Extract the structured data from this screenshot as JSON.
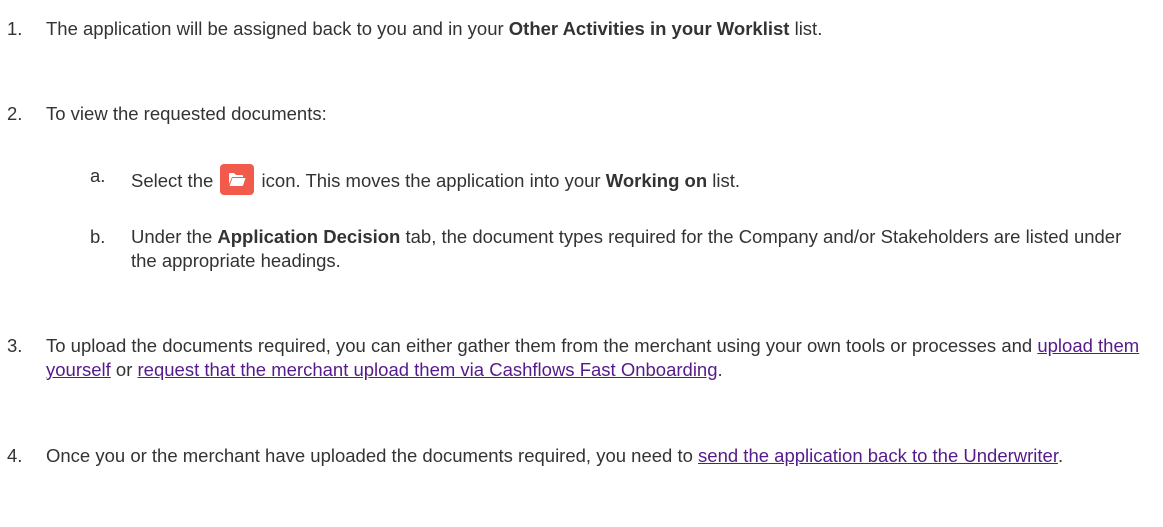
{
  "steps": [
    {
      "num": "1.",
      "pre": "The application will be assigned back to you and in your ",
      "bold": "Other Activities in your Worklist",
      "post": " list."
    },
    {
      "num": "2.",
      "text": "To view the requested documents:",
      "substeps": [
        {
          "num": "a.",
          "pre": "Select the ",
          "icon": "folder-open-icon",
          "mid": " icon. This moves the application into your ",
          "bold": "Working on",
          "post": " list."
        },
        {
          "num": "b.",
          "pre": "Under the ",
          "bold": "Application Decision",
          "post": " tab, the document types required for the Company and/or Stakeholders are listed under the appropriate headings."
        }
      ]
    },
    {
      "num": "3.",
      "pre": "To upload the documents required, you can either gather them from the merchant using your own tools or processes and ",
      "link1": "upload them yourself",
      "mid": " or ",
      "link2": "request that the merchant upload them via Cashflows Fast Onboarding",
      "post": "."
    },
    {
      "num": "4.",
      "pre": "Once you or the merchant have uploaded the documents required, you need to ",
      "link": "send the application back to the Underwriter",
      "post": "."
    }
  ],
  "colors": {
    "text": "#333333",
    "link": "#551a8b",
    "icon_bg": "#f25a4c"
  }
}
